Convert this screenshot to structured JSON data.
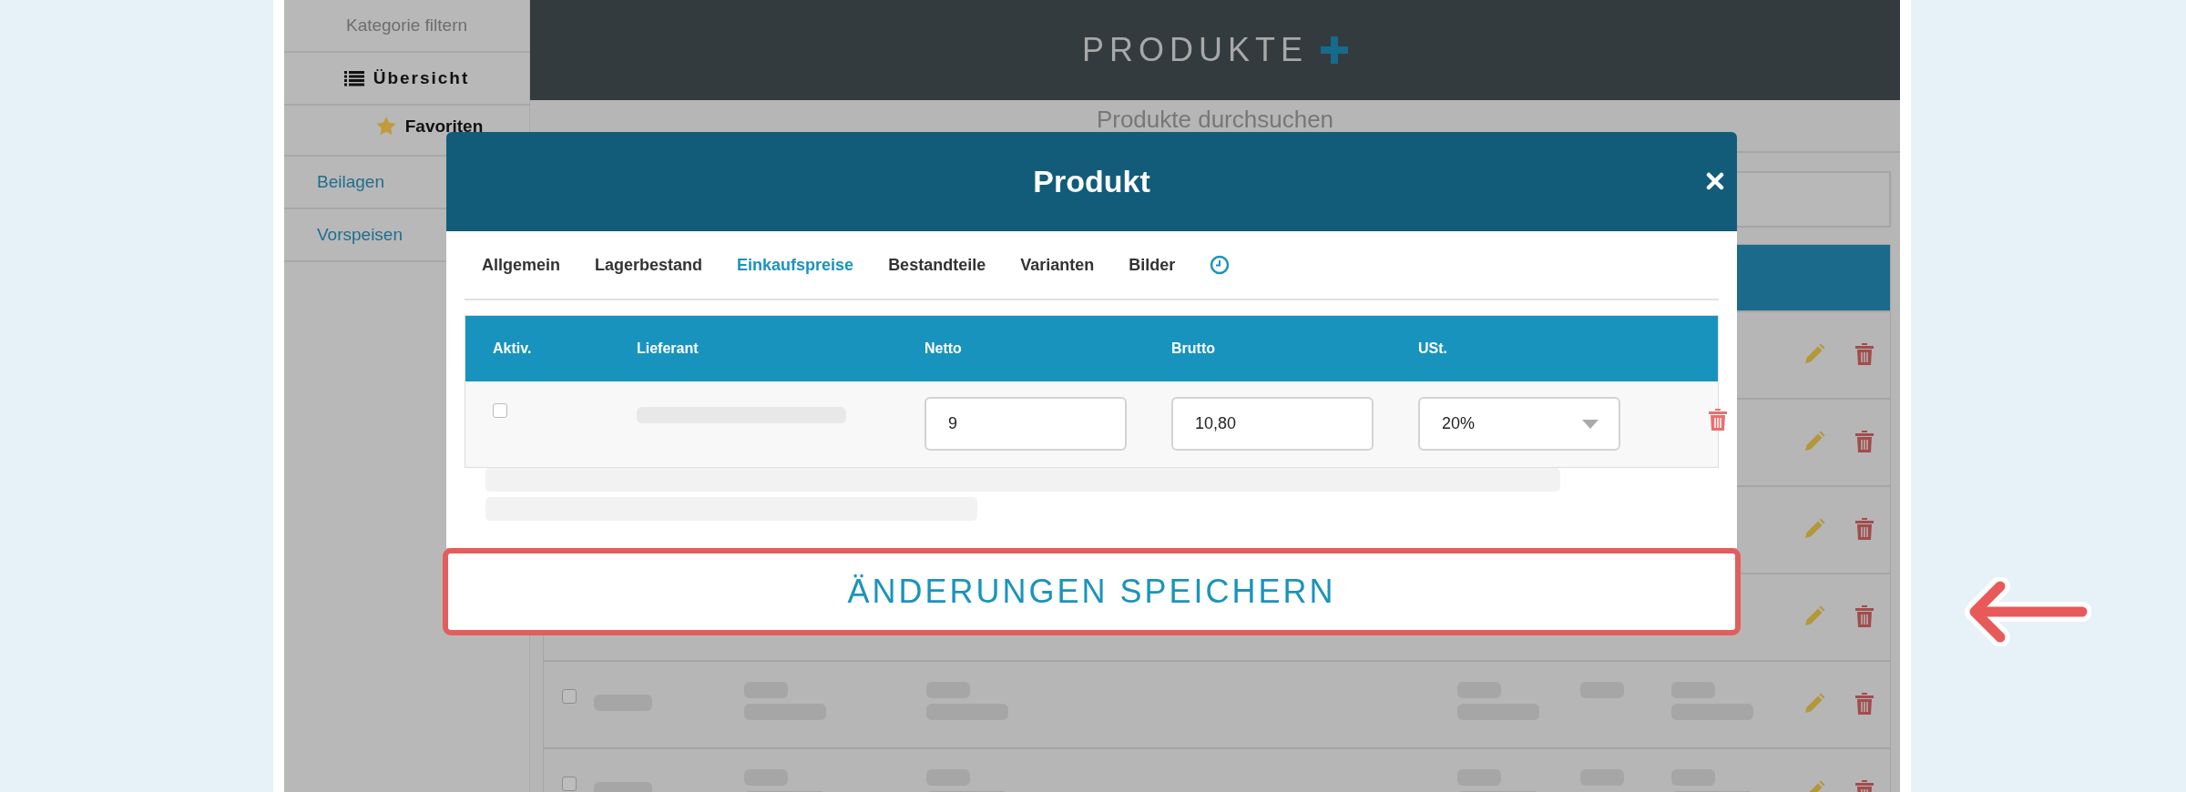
{
  "sidebar": {
    "filter_label": "Kategorie filtern",
    "items": [
      {
        "label": "Übersicht",
        "kind": "overview"
      },
      {
        "label": "Favoriten",
        "kind": "favorites"
      },
      {
        "label": "Beilagen",
        "kind": "category"
      },
      {
        "label": "Vorspeisen",
        "kind": "category"
      }
    ]
  },
  "header": {
    "title": "PRODUKTE"
  },
  "search": {
    "label": "Produkte durchsuchen"
  },
  "list_rows": [
    {
      "kind": "actions"
    },
    {
      "kind": "actions"
    },
    {
      "kind": "actions"
    },
    {
      "kind": "actions"
    },
    {
      "kind": "full",
      "checked": false
    },
    {
      "kind": "full",
      "checked": false
    }
  ],
  "modal": {
    "title": "Produkt",
    "tabs": [
      {
        "label": "Allgemein",
        "kind": "text",
        "selected": false
      },
      {
        "label": "Lagerbestand",
        "kind": "text",
        "selected": false
      },
      {
        "label": "Einkaufspreise",
        "kind": "text",
        "selected": true
      },
      {
        "label": "Bestandteile",
        "kind": "text",
        "selected": false
      },
      {
        "label": "Varianten",
        "kind": "text",
        "selected": false
      },
      {
        "label": "Bilder",
        "kind": "text",
        "selected": false
      },
      {
        "kind": "history",
        "selected": false
      }
    ],
    "columns": [
      "Aktiv.",
      "Lieferant",
      "Netto",
      "Brutto",
      "USt."
    ],
    "rows": [
      {
        "active": false,
        "netto": "9",
        "brutto": "10,80",
        "ust": "20%"
      }
    ],
    "save_button": "ÄNDERUNGEN SPEICHERN"
  }
}
